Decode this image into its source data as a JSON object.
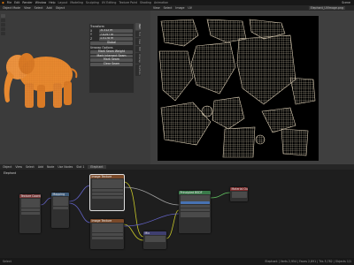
{
  "topbar": {
    "menus": [
      "File",
      "Edit",
      "Render",
      "Window",
      "Help"
    ],
    "workspaces": [
      "Layout",
      "Modeling",
      "Sculpting",
      "UV Editing",
      "Texture Paint",
      "Shading",
      "Animation"
    ],
    "scene_label": "Scene"
  },
  "viewport": {
    "header_items": [
      "Object Mode",
      "View",
      "Select",
      "Add",
      "Object"
    ],
    "subject_color": "#e8892f",
    "npanel": {
      "section_transform": "Transform",
      "rows": [
        {
          "label": "X",
          "value": "-0.312 m"
        },
        {
          "label": "Y",
          "value": "7.0297 m"
        },
        {
          "label": "Z",
          "value": "1.5178 m"
        }
      ],
      "mode_label": "Global",
      "section_ops": "Unwrap Options",
      "buttons": [
        "Mark Seam Weight",
        "Mark Intersect Seam",
        "Mark Seam",
        "Clear Seam"
      ]
    },
    "side_tabs": [
      "Item",
      "Tool",
      "View",
      "Edit",
      "Unwrap",
      "TexTools"
    ]
  },
  "uv_editor": {
    "header_items": [
      "View",
      "Select",
      "Image",
      "UV"
    ],
    "image_name": "Elephant_UVImage.png",
    "mesh_color": "#d8cbb2"
  },
  "node_editor": {
    "header_items": [
      "Object",
      "View",
      "Select",
      "Add",
      "Node",
      "Use Nodes"
    ],
    "material_name": "Elephant",
    "slot_label": "Slot 1",
    "nodes": [
      {
        "title": "Texture Coordinate",
        "color": "#7a3b3b"
      },
      {
        "title": "Mapping",
        "color": "#3d5b7a"
      },
      {
        "title": "Image Texture",
        "color": "#7a4a2a"
      },
      {
        "title": "Image Texture",
        "color": "#7a4a2a"
      },
      {
        "title": "Mix",
        "color": "#3f3f70"
      },
      {
        "title": "Principled BSDF",
        "color": "#3a7a4a"
      },
      {
        "title": "Material Output",
        "color": "#7a2a2a"
      }
    ]
  },
  "status": {
    "left": "Select",
    "right": "Elephant | Verts 2,954 | Faces 2,891 | Tris 5,782 | Objects 1/1"
  }
}
